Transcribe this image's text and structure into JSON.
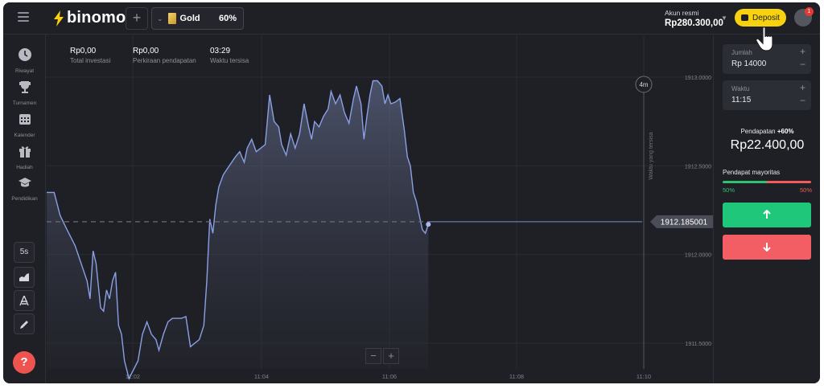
{
  "header": {
    "logo_text": "binomo",
    "add_asset_label": "+",
    "asset": {
      "name": "Gold",
      "payout": "60%"
    },
    "account": {
      "label": "Akun resmi",
      "balance": "Rp280.300,00"
    },
    "deposit_label": "Deposit",
    "notifications": "1"
  },
  "sidebar": {
    "items": [
      {
        "label": "Riwayat",
        "icon": "clock-icon"
      },
      {
        "label": "Turnamen",
        "icon": "trophy-icon"
      },
      {
        "label": "Kalender",
        "icon": "calendar-icon"
      },
      {
        "label": "Hadiah",
        "icon": "gift-icon"
      },
      {
        "label": "Pendidikan",
        "icon": "graduation-cap-icon"
      }
    ],
    "tools": [
      {
        "label": "5s",
        "icon": "timeframe-icon"
      },
      {
        "label": "",
        "icon": "chart-type-icon"
      },
      {
        "label": "",
        "icon": "indicators-icon"
      },
      {
        "label": "",
        "icon": "pencil-icon"
      }
    ],
    "help_label": "?"
  },
  "stats": [
    {
      "value": "Rp0,00",
      "label": "Total investasi"
    },
    {
      "value": "Rp0,00",
      "label": "Perkiraan pendapatan"
    },
    {
      "value": "03:29",
      "label": "Waktu tersisa"
    }
  ],
  "chart_data": {
    "type": "area",
    "x_ticks": [
      "11:02",
      "11:04",
      "11:06",
      "11:08",
      "11:10"
    ],
    "y_ticks": [
      "1913.0000",
      "1912.5000",
      "1912.0000",
      "1911.5000"
    ],
    "ylim": [
      1911.4,
      1913.1
    ],
    "current_price": "1912.185001",
    "current_price_value": 1912.185001,
    "expiry_marker": "4m",
    "expiry_label": "Waktu yang tersisa",
    "x_start": "11:01:20",
    "x_end": "11:10:50",
    "series": [
      {
        "values": [
          [
            5,
            1912.35
          ],
          [
            9,
            1912.22
          ],
          [
            13,
            1912.15
          ],
          [
            19,
            1912.05
          ],
          [
            23,
            1911.95
          ],
          [
            27,
            1911.85
          ],
          [
            29,
            1911.75
          ],
          [
            31,
            1912.02
          ],
          [
            33,
            1911.95
          ],
          [
            36,
            1911.7
          ],
          [
            38,
            1911.68
          ],
          [
            40,
            1911.8
          ],
          [
            42,
            1911.75
          ],
          [
            44,
            1911.85
          ],
          [
            46,
            1911.9
          ],
          [
            48,
            1911.6
          ],
          [
            50,
            1911.55
          ],
          [
            52,
            1911.4
          ],
          [
            55,
            1911.3
          ],
          [
            58,
            1911.35
          ],
          [
            61,
            1911.4
          ],
          [
            64,
            1911.55
          ],
          [
            67,
            1911.62
          ],
          [
            70,
            1911.55
          ],
          [
            73,
            1911.52
          ],
          [
            75,
            1911.46
          ],
          [
            78,
            1911.55
          ],
          [
            81,
            1911.62
          ],
          [
            84,
            1911.64
          ],
          [
            87,
            1911.64
          ],
          [
            90,
            1911.64
          ],
          [
            93,
            1911.65
          ],
          [
            96,
            1911.48
          ],
          [
            99,
            1911.5
          ],
          [
            102,
            1911.52
          ],
          [
            105,
            1911.6
          ],
          [
            107,
            1911.85
          ],
          [
            109,
            1912.2
          ],
          [
            111,
            1912.12
          ],
          [
            113,
            1912.28
          ],
          [
            115,
            1912.38
          ],
          [
            118,
            1912.45
          ],
          [
            122,
            1912.5
          ],
          [
            126,
            1912.55
          ],
          [
            129,
            1912.58
          ],
          [
            132,
            1912.52
          ],
          [
            134,
            1912.6
          ],
          [
            137,
            1912.65
          ],
          [
            140,
            1912.58
          ],
          [
            143,
            1912.6
          ],
          [
            146,
            1912.62
          ],
          [
            149,
            1912.9
          ],
          [
            152,
            1912.75
          ],
          [
            155,
            1912.72
          ],
          [
            157,
            1912.62
          ],
          [
            160,
            1912.56
          ],
          [
            163,
            1912.68
          ],
          [
            166,
            1912.6
          ],
          [
            169,
            1912.68
          ],
          [
            172,
            1912.85
          ],
          [
            175,
            1912.72
          ],
          [
            177,
            1912.65
          ],
          [
            179,
            1912.75
          ],
          [
            182,
            1912.72
          ],
          [
            185,
            1912.78
          ],
          [
            188,
            1912.82
          ],
          [
            190,
            1912.92
          ],
          [
            193,
            1912.85
          ],
          [
            196,
            1912.9
          ],
          [
            199,
            1912.8
          ],
          [
            202,
            1912.74
          ],
          [
            205,
            1912.88
          ],
          [
            207,
            1912.95
          ],
          [
            210,
            1912.85
          ],
          [
            212,
            1912.65
          ],
          [
            214,
            1912.78
          ],
          [
            216,
            1912.9
          ],
          [
            218,
            1912.98
          ],
          [
            221,
            1912.98
          ],
          [
            224,
            1912.95
          ],
          [
            226,
            1912.85
          ],
          [
            228,
            1912.9
          ],
          [
            230,
            1912.85
          ],
          [
            233,
            1912.86
          ],
          [
            236,
            1912.88
          ],
          [
            239,
            1912.7
          ],
          [
            241,
            1912.55
          ],
          [
            243,
            1912.5
          ],
          [
            245,
            1912.35
          ],
          [
            247,
            1912.3
          ],
          [
            249,
            1912.22
          ],
          [
            251,
            1912.14
          ],
          [
            253,
            1912.12
          ],
          [
            255,
            1912.17
          ]
        ]
      }
    ]
  },
  "panel": {
    "amount": {
      "label": "Jumlah",
      "value": "Rp 14000"
    },
    "time": {
      "label": "Waktu",
      "value": "11:15"
    },
    "payout_label": "Pendapatan",
    "payout_percent": "+60%",
    "payout_value": "Rp22.400,00",
    "majority_label": "Pendapat mayoritas",
    "majority_up_percent": "50%",
    "majority_down_percent": "50%",
    "majority_up": 50,
    "colors": {
      "up": "#1fc77a",
      "down": "#f25e63",
      "accent": "#f8d20f"
    }
  },
  "zoom": {
    "minus": "−",
    "plus": "+"
  }
}
